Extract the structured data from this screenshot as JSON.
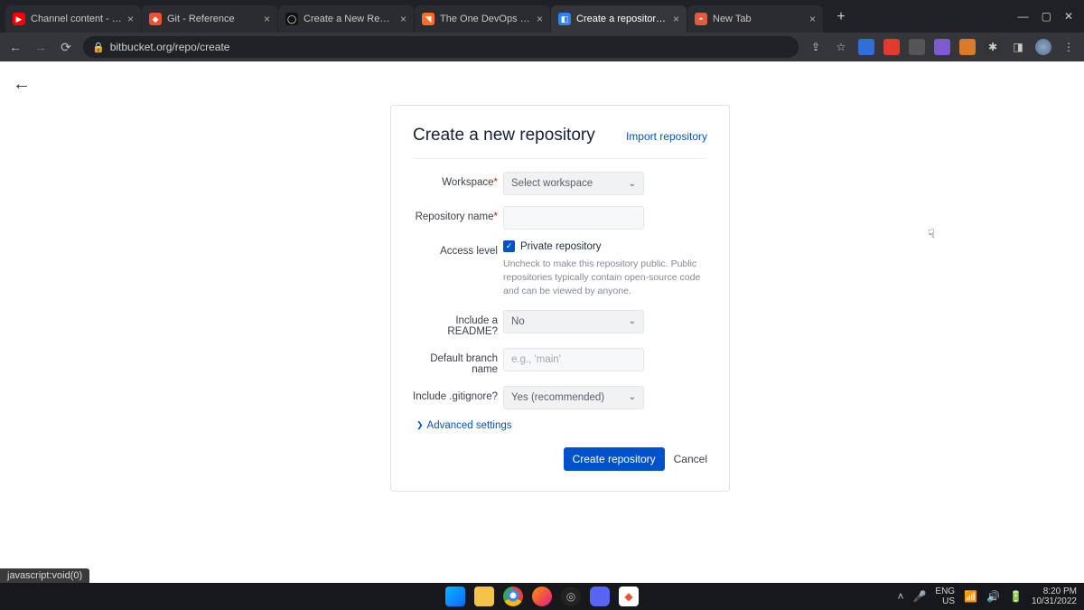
{
  "browser": {
    "tabs": [
      {
        "title": "Channel content - YouTube Stu"
      },
      {
        "title": "Git - Reference"
      },
      {
        "title": "Create a New Repository"
      },
      {
        "title": "The One DevOps Platform | GitL"
      },
      {
        "title": "Create a repository — Bitbucket"
      },
      {
        "title": "New Tab"
      }
    ],
    "url": "bitbucket.org/repo/create",
    "status_text": "javascript:void(0)"
  },
  "form": {
    "title": "Create a new repository",
    "import_link": "Import repository",
    "workspace": {
      "label": "Workspace",
      "value": "Select workspace"
    },
    "repo_name": {
      "label": "Repository name",
      "value": ""
    },
    "access": {
      "label": "Access level",
      "checkbox_label": "Private repository",
      "checked": true,
      "hint": "Uncheck to make this repository public. Public repositories typically contain open-source code and can be viewed by anyone."
    },
    "readme": {
      "label": "Include a README?",
      "value": "No"
    },
    "branch": {
      "label": "Default branch name",
      "placeholder": "e.g., 'main'",
      "value": ""
    },
    "gitignore": {
      "label": "Include .gitignore?",
      "value": "Yes (recommended)"
    },
    "advanced": "Advanced settings",
    "submit": "Create repository",
    "cancel": "Cancel"
  },
  "system": {
    "lang1": "ENG",
    "lang2": "US",
    "time": "8:20 PM",
    "date": "10/31/2022"
  }
}
